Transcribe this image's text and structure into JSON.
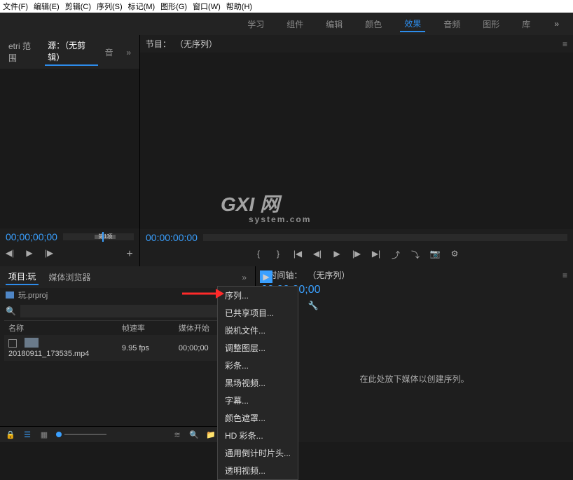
{
  "menubar": {
    "file": "文件(F)",
    "edit": "编辑(E)",
    "clip": "剪辑(C)",
    "sequence": "序列(S)",
    "marker": "标记(M)",
    "graphics": "图形(G)",
    "window": "窗口(W)",
    "help": "帮助(H)"
  },
  "workspaces": {
    "learn": "学习",
    "assembly": "组件",
    "editing": "编辑",
    "color": "颜色",
    "effects": "效果",
    "audio": "音频",
    "graphics": "图形",
    "libraries": "库",
    "more": "»"
  },
  "source_tabs": {
    "lumetri": "etri 范围",
    "source": "源：（无剪辑）",
    "audio": "音",
    "more": "»"
  },
  "source": {
    "timecode": "00;00;00;00",
    "track_label": "第1项"
  },
  "program": {
    "title_prefix": "节目：",
    "title": "（无序列）",
    "gear": "≡",
    "timecode": "00:00:00:00"
  },
  "project": {
    "tabs": {
      "project": "项目:玩",
      "browser": "媒体浏览器",
      "more": "»"
    },
    "crumb": "玩.prproj",
    "search_placeholder": "",
    "cols": {
      "name": "名称",
      "fps": "帧速率",
      "start": "媒体开始"
    },
    "rows": [
      {
        "name": "20180911_173535.mp4",
        "fps": "9.95 fps",
        "start": "00;00;00"
      }
    ]
  },
  "ctx": {
    "sequence": "序列...",
    "shared": "已共享项目...",
    "offline": "脱机文件...",
    "adjust": "调整图层...",
    "bars": "彩条...",
    "black": "黑场视频...",
    "caption": "字幕...",
    "matte": "颜色遮罩...",
    "hd": "HD 彩条...",
    "leader": "通用倒计时片头...",
    "transparent": "透明视频..."
  },
  "timeline": {
    "title_prefix": "× 时间轴：",
    "title": "（无序列）",
    "gear": "≡",
    "timecode": "00;00;00;00",
    "drop_hint": "在此处放下媒体以创建序列。"
  },
  "watermark": {
    "big": "GXI 网",
    "small": "system.com"
  }
}
